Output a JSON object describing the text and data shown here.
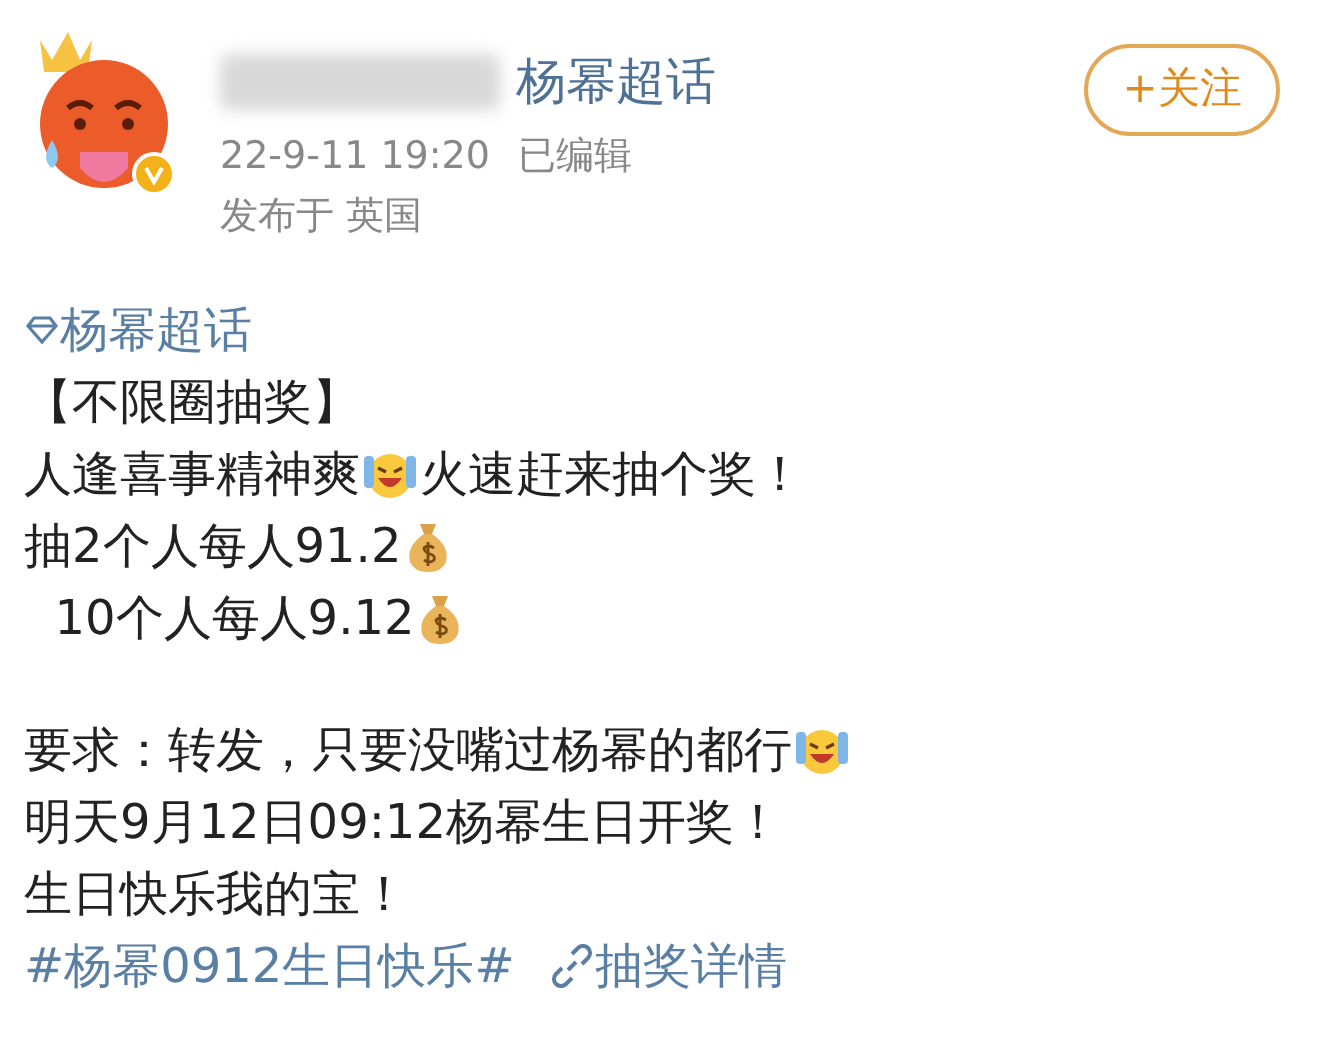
{
  "post": {
    "author_topic": "杨幂超话",
    "timestamp": "22-9-11 19:20",
    "edited": "已编辑",
    "location": "发布于 英国",
    "verified": true,
    "follow_button": "+关注"
  },
  "body": {
    "topic": "杨幂超话",
    "lines": [
      {
        "parts": [
          {
            "kind": "text",
            "text": "【不限圈抽奖】"
          }
        ]
      },
      {
        "parts": [
          {
            "kind": "text",
            "text": "人逢喜事精神爽"
          },
          {
            "kind": "cheer"
          },
          {
            "kind": "text",
            "text": "火速赶来抽个奖！"
          }
        ]
      },
      {
        "parts": [
          {
            "kind": "text",
            "text": "抽2个人每人91.2"
          },
          {
            "kind": "money"
          }
        ]
      },
      {
        "parts": [
          {
            "kind": "text",
            "text": "  10个人每人9.12"
          },
          {
            "kind": "money"
          }
        ]
      },
      {
        "gap_before": true,
        "parts": [
          {
            "kind": "text",
            "text": "要求：转发，只要没嘴过杨幂的都行"
          },
          {
            "kind": "cheer"
          }
        ]
      },
      {
        "parts": [
          {
            "kind": "text",
            "text": "明天9月12日09:12杨幂生日开奖！"
          }
        ]
      },
      {
        "parts": [
          {
            "kind": "text",
            "text": "生日快乐我的宝！"
          }
        ]
      }
    ],
    "hashtag": "#杨幂0912生日快乐#",
    "lottery_link": "抽奖详情"
  }
}
